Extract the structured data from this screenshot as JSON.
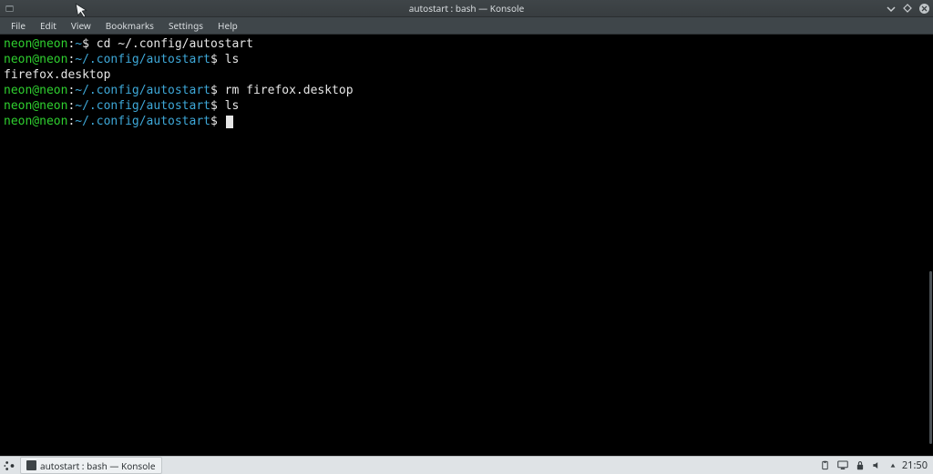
{
  "window": {
    "title": "autostart : bash — Konsole"
  },
  "menu": {
    "items": [
      "File",
      "Edit",
      "View",
      "Bookmarks",
      "Settings",
      "Help"
    ]
  },
  "terminal": {
    "lines": [
      {
        "user": "neon@neon",
        "sep": ":",
        "path": "~",
        "prompt": "$",
        "cmd": "cd ~/.config/autostart"
      },
      {
        "user": "neon@neon",
        "sep": ":",
        "path": "~/.config/autostart",
        "prompt": "$",
        "cmd": "ls"
      },
      {
        "output": "firefox.desktop"
      },
      {
        "user": "neon@neon",
        "sep": ":",
        "path": "~/.config/autostart",
        "prompt": "$",
        "cmd": "rm firefox.desktop"
      },
      {
        "user": "neon@neon",
        "sep": ":",
        "path": "~/.config/autostart",
        "prompt": "$",
        "cmd": "ls"
      },
      {
        "user": "neon@neon",
        "sep": ":",
        "path": "~/.config/autostart",
        "prompt": "$",
        "cmd": "",
        "cursor": true
      }
    ]
  },
  "panel": {
    "task_label": "autostart : bash — Konsole",
    "clock": "21:50"
  }
}
